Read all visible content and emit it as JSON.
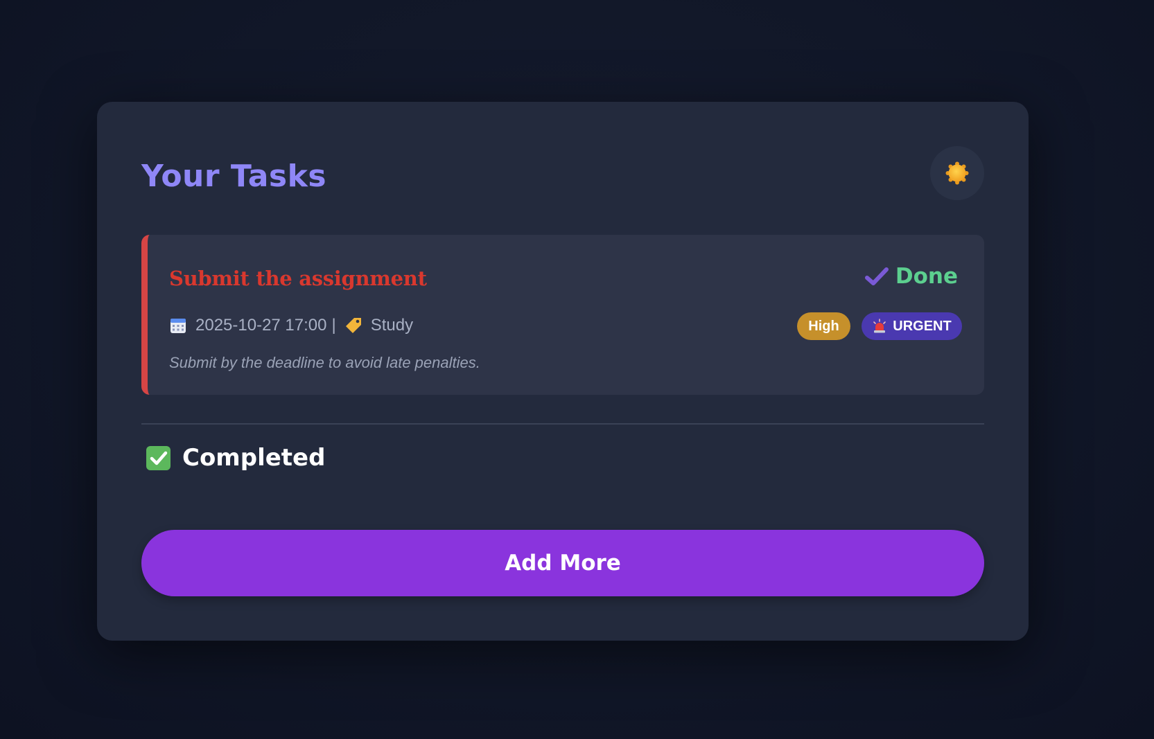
{
  "header": {
    "title": "Your Tasks",
    "theme_toggle_icon": "sun-icon"
  },
  "tasks": [
    {
      "title": "Submit the assignment",
      "done_label": "Done",
      "done_icon": "check-icon",
      "datetime": "2025-10-27 17:00",
      "separator": "|",
      "category": "Study",
      "priority": "High",
      "urgent_label": "URGENT",
      "description": "Submit by the deadline to avoid late penalties.",
      "colors": {
        "accent": "#d64545",
        "title": "#d9382e",
        "done": "#5ccf8f",
        "priority_badge": "#c6902b",
        "urgent_badge": "#4a39b0"
      }
    }
  ],
  "completed_section": {
    "label": "Completed",
    "icon": "checkbox-icon"
  },
  "add_button": {
    "label": "Add More",
    "color": "#8a34dd"
  }
}
